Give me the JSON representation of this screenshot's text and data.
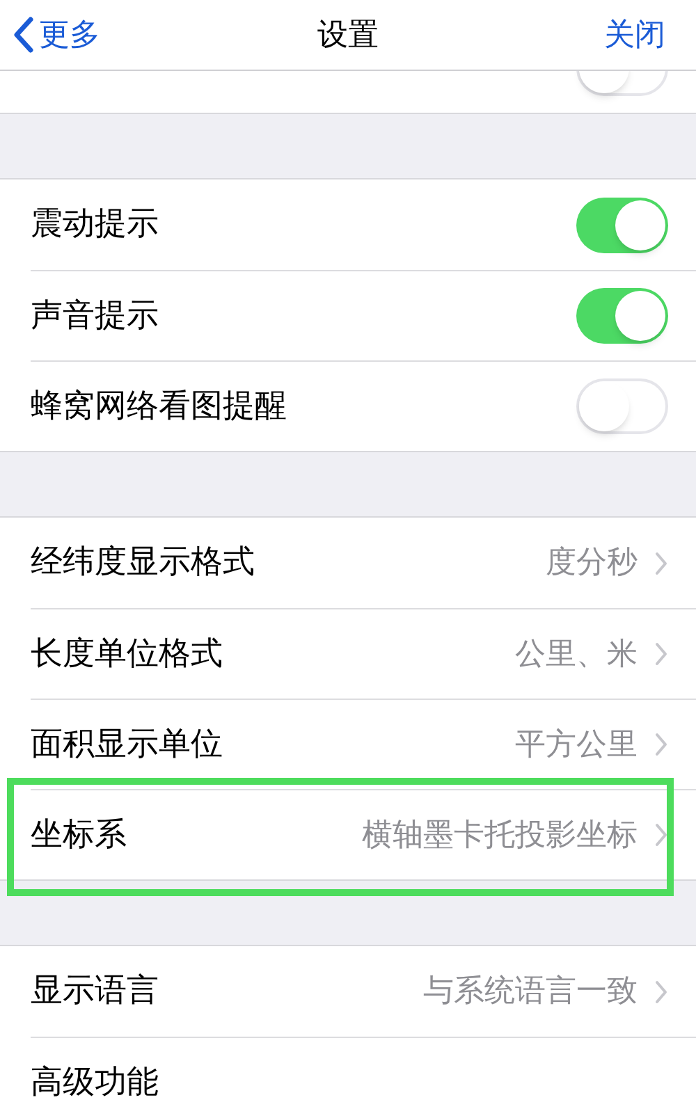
{
  "nav_bar": {
    "back": "更多",
    "title": "设置",
    "close": "关闭"
  },
  "sections": [
    {
      "items": [
        {
          "kind": "toggle",
          "on": false
        }
      ],
      "cut_top": true
    },
    {
      "items": [
        {
          "kind": "toggle",
          "label": "震动提示",
          "on": true
        },
        {
          "kind": "toggle",
          "label": "声音提示",
          "on": true
        },
        {
          "kind": "toggle",
          "label": "蜂窝网络看图提醒",
          "on": false
        }
      ]
    },
    {
      "items": [
        {
          "kind": "detail",
          "label": "经纬度显示格式",
          "value": "度分秒",
          "highlighted": false
        },
        {
          "kind": "detail",
          "label": "长度单位格式",
          "value": "公里、米",
          "highlighted": false
        },
        {
          "kind": "detail",
          "label": "面积显示单位",
          "value": "平方公里",
          "highlighted": false
        },
        {
          "kind": "detail",
          "label": "坐标系",
          "value": "横轴墨卡托投影坐标",
          "highlighted": true
        }
      ]
    },
    {
      "items": [
        {
          "kind": "detail",
          "label": "显示语言",
          "value": "与系统语言一致",
          "highlighted": false
        },
        {
          "kind": "plain",
          "label": "高级功能"
        }
      ]
    }
  ]
}
